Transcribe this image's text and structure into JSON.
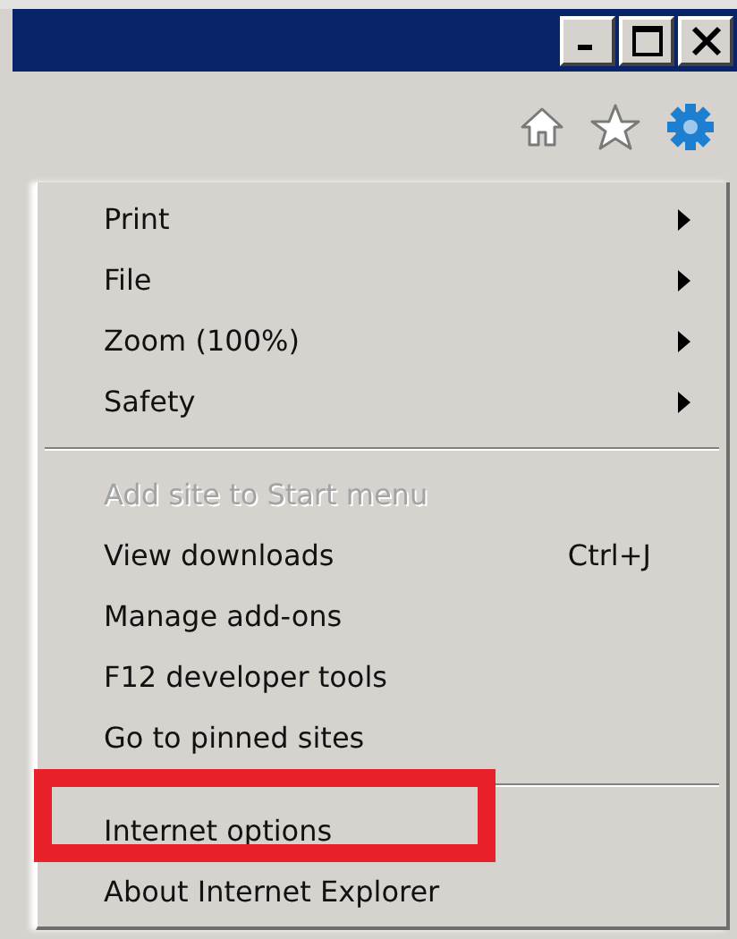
{
  "window": {
    "buttons": [
      {
        "kind": "minimize"
      },
      {
        "kind": "maximize"
      },
      {
        "kind": "close"
      }
    ]
  },
  "toolbar": {
    "icons": [
      {
        "kind": "home"
      },
      {
        "kind": "star"
      },
      {
        "kind": "gear"
      }
    ]
  },
  "menu": {
    "items": [
      {
        "kind": "item",
        "label": "Print",
        "submenu": true,
        "disabled": false,
        "highlighted": false
      },
      {
        "kind": "item",
        "label": "File",
        "submenu": true,
        "disabled": false,
        "highlighted": false
      },
      {
        "kind": "item",
        "label": "Zoom (100%)",
        "submenu": true,
        "disabled": false,
        "highlighted": false
      },
      {
        "kind": "item",
        "label": "Safety",
        "submenu": true,
        "disabled": false,
        "highlighted": false
      },
      {
        "kind": "separator"
      },
      {
        "kind": "item",
        "label": "Add site to Start menu",
        "submenu": false,
        "disabled": true,
        "highlighted": false
      },
      {
        "kind": "item",
        "label": "View downloads",
        "shortcut": "Ctrl+J",
        "submenu": false,
        "disabled": false,
        "highlighted": false
      },
      {
        "kind": "item",
        "label": "Manage add-ons",
        "submenu": false,
        "disabled": false,
        "highlighted": false
      },
      {
        "kind": "item",
        "label": "F12 developer tools",
        "submenu": false,
        "disabled": false,
        "highlighted": false
      },
      {
        "kind": "item",
        "label": "Go to pinned sites",
        "submenu": false,
        "disabled": false,
        "highlighted": false
      },
      {
        "kind": "separator"
      },
      {
        "kind": "item",
        "label": "Internet options",
        "submenu": false,
        "disabled": false,
        "highlighted": true
      },
      {
        "kind": "item",
        "label": "About Internet Explorer",
        "submenu": false,
        "disabled": false,
        "highlighted": false
      }
    ]
  }
}
